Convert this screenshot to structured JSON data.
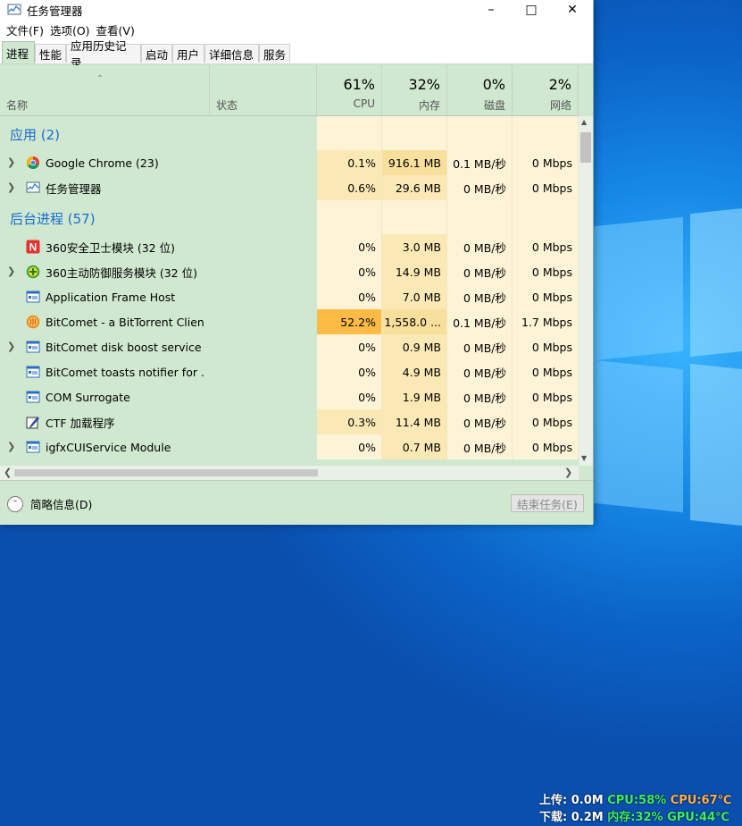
{
  "window": {
    "title": "任务管理器"
  },
  "menu": [
    "文件(F)",
    "选项(O)",
    "查看(V)"
  ],
  "tabs": [
    "进程",
    "性能",
    "应用历史记录",
    "启动",
    "用户",
    "详细信息",
    "服务"
  ],
  "columns": {
    "name": "名称",
    "status": "状态",
    "cpu": {
      "pct": "61%",
      "label": "CPU"
    },
    "mem": {
      "pct": "32%",
      "label": "内存"
    },
    "disk": {
      "pct": "0%",
      "label": "磁盘"
    },
    "net": {
      "pct": "2%",
      "label": "网络"
    }
  },
  "groups": {
    "apps": "应用 (2)",
    "background": "后台进程 (57)"
  },
  "apps": [
    {
      "name": "Google Chrome (23)",
      "icon": "chrome-icon",
      "expand": true,
      "cpu": "0.1%",
      "mem": "916.1 MB",
      "disk": "0.1 MB/秒",
      "net": "0 Mbps"
    },
    {
      "name": "任务管理器",
      "icon": "task-manager-icon",
      "expand": true,
      "cpu": "0.6%",
      "mem": "29.6 MB",
      "disk": "0 MB/秒",
      "net": "0 Mbps"
    }
  ],
  "background": [
    {
      "name": "360安全卫士模块 (32 位)",
      "icon": "360-icon",
      "expand": false,
      "cpu": "0%",
      "mem": "3.0 MB",
      "disk": "0 MB/秒",
      "net": "0 Mbps"
    },
    {
      "name": "360主动防御服务模块 (32 位)",
      "icon": "360-shield-icon",
      "expand": true,
      "cpu": "0%",
      "mem": "14.9 MB",
      "disk": "0 MB/秒",
      "net": "0 Mbps"
    },
    {
      "name": "Application Frame Host",
      "icon": "app-window-icon",
      "expand": false,
      "cpu": "0%",
      "mem": "7.0 MB",
      "disk": "0 MB/秒",
      "net": "0 Mbps"
    },
    {
      "name": "BitComet - a BitTorrent Client",
      "icon": "bitcomet-icon",
      "expand": false,
      "cpu": "52.2%",
      "mem": "1,558.0 ...",
      "disk": "0.1 MB/秒",
      "net": "1.7 Mbps"
    },
    {
      "name": "BitComet disk boost service ...",
      "icon": "app-window-icon",
      "expand": true,
      "cpu": "0%",
      "mem": "0.9 MB",
      "disk": "0 MB/秒",
      "net": "0 Mbps"
    },
    {
      "name": "BitComet toasts notifier for ...",
      "icon": "app-window-icon",
      "expand": false,
      "cpu": "0%",
      "mem": "4.9 MB",
      "disk": "0 MB/秒",
      "net": "0 Mbps"
    },
    {
      "name": "COM Surrogate",
      "icon": "app-window-icon",
      "expand": false,
      "cpu": "0%",
      "mem": "1.9 MB",
      "disk": "0 MB/秒",
      "net": "0 Mbps"
    },
    {
      "name": "CTF 加载程序",
      "icon": "ctf-pen-icon",
      "expand": false,
      "cpu": "0.3%",
      "mem": "11.4 MB",
      "disk": "0 MB/秒",
      "net": "0 Mbps"
    },
    {
      "name": "igfxCUIService Module",
      "icon": "app-window-icon",
      "expand": true,
      "cpu": "0%",
      "mem": "0.7 MB",
      "disk": "0 MB/秒",
      "net": "0 Mbps"
    }
  ],
  "footer": {
    "fewer_details": "简略信息(D)",
    "end_task": "结束任务(E)"
  },
  "monitor": {
    "upload_label": "上传:",
    "upload": "0.0M",
    "cpu": "CPU:58%",
    "cpu_temp": "CPU:67℃",
    "download_label": "下载:",
    "download": "0.2M",
    "mem": "内存:32%",
    "gpu_temp": "GPU:44℃"
  }
}
